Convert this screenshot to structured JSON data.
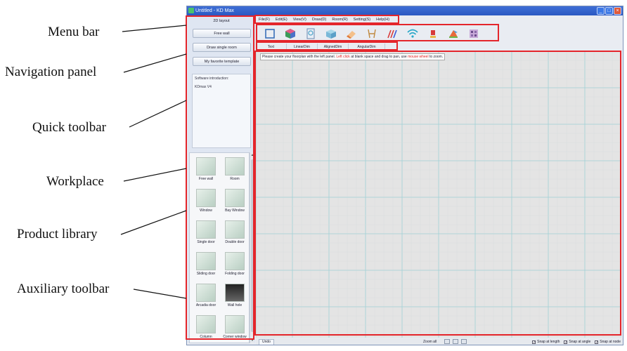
{
  "annotations": [
    {
      "id": "menu-bar",
      "label": "Menu bar"
    },
    {
      "id": "navigation-panel",
      "label": "Navigation panel"
    },
    {
      "id": "quick-toolbar",
      "label": "Quick toolbar"
    },
    {
      "id": "workplace",
      "label": "Workplace"
    },
    {
      "id": "product-library",
      "label": "Product library"
    },
    {
      "id": "auxiliary-toolbar",
      "label": "Auxiliary toolbar"
    }
  ],
  "window": {
    "title": "Untitled - KD Max",
    "controls": [
      "minimize-icon",
      "maximize-icon",
      "close-icon"
    ]
  },
  "navigation": {
    "title": "2D layout",
    "buttons": [
      "Free wall",
      "Draw single room",
      "My favorite template"
    ],
    "intro_title": "Software introduction:",
    "intro_text": "KDmax V4"
  },
  "menu": [
    "File(F)",
    "Edit(E)",
    "View(V)",
    "Draw(D)",
    "Room(R)",
    "Setting(S)",
    "Help(H)"
  ],
  "toolbar_icons": [
    "room-outline-icon",
    "cube-icon",
    "document-icon",
    "box-icon",
    "eraser-icon",
    "chair-icon",
    "pencil-icon",
    "wifi-icon",
    "lamp-icon",
    "paint-icon",
    "grid-icon"
  ],
  "aux_toolbar": [
    "Text",
    "LinearDim",
    "AlignedDim",
    "AngularDim"
  ],
  "hint": {
    "prefix": "Please create your floorplan with the left panel.",
    "red1": "Left click",
    "middle": "at blank space and drag to pan, use",
    "red2": "mouse wheel",
    "suffix": "to zoom."
  },
  "library": [
    "Free wall",
    "Room",
    "Window",
    "Bay Window",
    "Single door",
    "Double door",
    "Sliding door",
    "Folding door",
    "Arcadia door",
    "Wall hole",
    "Column",
    "Corner window"
  ],
  "status": {
    "undo": "Undo",
    "zoom": "Zoom all",
    "snaps": [
      "Snap at length",
      "Snap at angle",
      "Snap at node"
    ]
  },
  "colors": {
    "highlight": "#e4252b",
    "titlebar": "#2a58c2",
    "grid": "#9fd0d6"
  }
}
